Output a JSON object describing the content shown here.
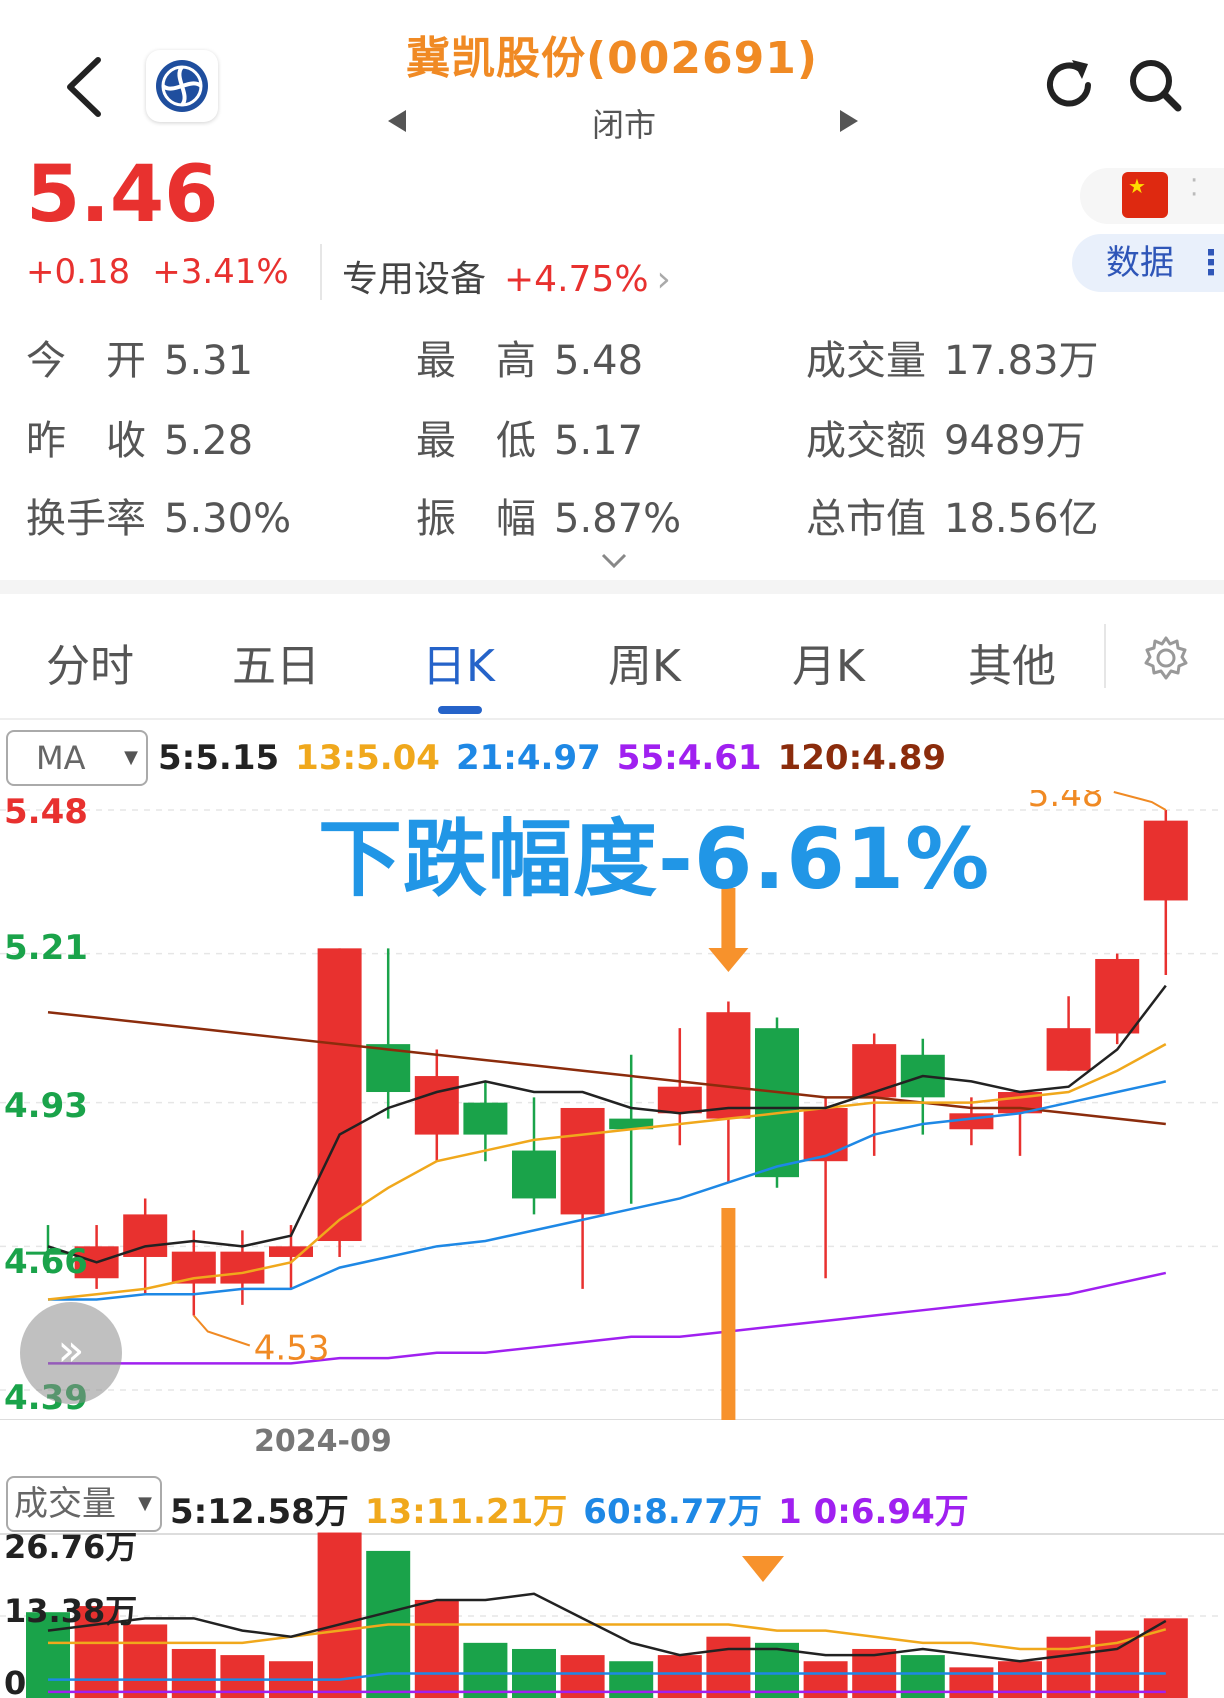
{
  "header": {
    "title": "冀凯股份(002691)",
    "status": "闭市",
    "back_icon": "chevron-left-icon",
    "refresh_icon": "refresh-icon",
    "search_icon": "search-icon"
  },
  "quote": {
    "price": "5.46",
    "change": "+0.18",
    "change_pct": "+3.41%",
    "sector": "专用设备",
    "sector_pct": "+4.75%",
    "data_button": "数据",
    "up_color": "#e8312f",
    "down_color": "#1aa34a"
  },
  "stats": [
    {
      "label": "今　开",
      "value": "5.31"
    },
    {
      "label": "最　高",
      "value": "5.48"
    },
    {
      "label": "成交量",
      "value": "17.83万"
    },
    {
      "label": "昨　收",
      "value": "5.28"
    },
    {
      "label": "最　低",
      "value": "5.17"
    },
    {
      "label": "成交额",
      "value": "9489万"
    },
    {
      "label": "换手率",
      "value": "5.30%"
    },
    {
      "label": "振　幅",
      "value": "5.87%"
    },
    {
      "label": "总市值",
      "value": "18.56亿"
    }
  ],
  "tabs": [
    "分时",
    "五日",
    "日K",
    "周K",
    "月K",
    "其他"
  ],
  "active_tab": "日K",
  "ma": {
    "selector": "MA",
    "legend": [
      {
        "text": "5:5.15",
        "color": "#222222"
      },
      {
        "text": "13:5.04",
        "color": "#f0a81c"
      },
      {
        "text": "21:4.97",
        "color": "#1e88e5"
      },
      {
        "text": "55:4.61",
        "color": "#a020f0"
      },
      {
        "text": "120:4.89",
        "color": "#8b2c0c"
      }
    ]
  },
  "price_axis": [
    {
      "text": "5.48",
      "color": "#e8312f"
    },
    {
      "text": "5.21",
      "color": "#1aa34a"
    },
    {
      "text": "4.93",
      "color": "#1aa34a"
    },
    {
      "text": "4.66",
      "color": "#1aa34a"
    },
    {
      "text": "4.39",
      "color": "#1aa34a"
    }
  ],
  "annotations": {
    "headline": "下跌幅度-6.61%",
    "high_marker": "5.48",
    "low_marker": "4.53",
    "date": "2024-09"
  },
  "volume": {
    "selector": "成交量",
    "legend": [
      {
        "text": "5:12.58万",
        "color": "#222222"
      },
      {
        "text": "13:11.21万",
        "color": "#f0a81c"
      },
      {
        "text": "60:8.77万",
        "color": "#1e88e5"
      },
      {
        "text": "1  0:6.94万",
        "color": "#a020f0"
      }
    ],
    "axis": [
      "26.76万",
      "13.38万",
      "0"
    ]
  },
  "chart_data": [
    {
      "type": "candlestick",
      "ylim": [
        4.39,
        5.48
      ],
      "candles": [
        {
          "o": 4.65,
          "c": 4.65,
          "h": 4.7,
          "l": 4.61,
          "up": false
        },
        {
          "o": 4.6,
          "c": 4.66,
          "h": 4.7,
          "l": 4.58,
          "up": true
        },
        {
          "o": 4.64,
          "c": 4.72,
          "h": 4.75,
          "l": 4.57,
          "up": true
        },
        {
          "o": 4.65,
          "c": 4.59,
          "h": 4.69,
          "l": 4.53,
          "up": true
        },
        {
          "o": 4.59,
          "c": 4.65,
          "h": 4.69,
          "l": 4.55,
          "up": true
        },
        {
          "o": 4.64,
          "c": 4.66,
          "h": 4.7,
          "l": 4.58,
          "up": true
        },
        {
          "o": 4.67,
          "c": 5.22,
          "h": 5.22,
          "l": 4.64,
          "up": true
        },
        {
          "o": 5.04,
          "c": 4.95,
          "h": 5.22,
          "l": 4.9,
          "up": false
        },
        {
          "o": 4.87,
          "c": 4.98,
          "h": 5.03,
          "l": 4.82,
          "up": true
        },
        {
          "o": 4.93,
          "c": 4.87,
          "h": 4.97,
          "l": 4.82,
          "up": false
        },
        {
          "o": 4.84,
          "c": 4.75,
          "h": 4.94,
          "l": 4.72,
          "up": false
        },
        {
          "o": 4.72,
          "c": 4.92,
          "h": 4.92,
          "l": 4.58,
          "up": true
        },
        {
          "o": 4.88,
          "c": 4.9,
          "h": 5.02,
          "l": 4.74,
          "up": false
        },
        {
          "o": 4.91,
          "c": 4.96,
          "h": 5.07,
          "l": 4.85,
          "up": true
        },
        {
          "o": 4.9,
          "c": 5.1,
          "h": 5.12,
          "l": 4.78,
          "up": true
        },
        {
          "o": 5.07,
          "c": 4.79,
          "h": 5.09,
          "l": 4.77,
          "up": false
        },
        {
          "o": 4.82,
          "c": 4.92,
          "h": 4.94,
          "l": 4.6,
          "up": true
        },
        {
          "o": 4.94,
          "c": 5.04,
          "h": 5.06,
          "l": 4.83,
          "up": true
        },
        {
          "o": 5.02,
          "c": 4.94,
          "h": 5.05,
          "l": 4.87,
          "up": false
        },
        {
          "o": 4.88,
          "c": 4.91,
          "h": 4.94,
          "l": 4.85,
          "up": true
        },
        {
          "o": 4.91,
          "c": 4.95,
          "h": 4.95,
          "l": 4.83,
          "up": true
        },
        {
          "o": 4.99,
          "c": 5.07,
          "h": 5.13,
          "l": 4.99,
          "up": true
        },
        {
          "o": 5.06,
          "c": 5.2,
          "h": 5.21,
          "l": 5.04,
          "up": true
        },
        {
          "o": 5.31,
          "c": 5.46,
          "h": 5.48,
          "l": 5.17,
          "up": true
        }
      ],
      "ma5": [
        4.66,
        4.63,
        4.66,
        4.67,
        4.66,
        4.68,
        4.87,
        4.92,
        4.95,
        4.97,
        4.95,
        4.95,
        4.92,
        4.91,
        4.92,
        4.92,
        4.92,
        4.95,
        4.98,
        4.97,
        4.95,
        4.96,
        5.03,
        5.15
      ],
      "ma13": [
        4.56,
        4.57,
        4.58,
        4.6,
        4.61,
        4.63,
        4.71,
        4.77,
        4.82,
        4.84,
        4.86,
        4.87,
        4.88,
        4.89,
        4.9,
        4.91,
        4.92,
        4.93,
        4.93,
        4.93,
        4.94,
        4.95,
        4.99,
        5.04
      ],
      "ma21": [
        4.56,
        4.56,
        4.57,
        4.57,
        4.58,
        4.58,
        4.62,
        4.64,
        4.66,
        4.67,
        4.69,
        4.71,
        4.73,
        4.75,
        4.78,
        4.81,
        4.83,
        4.87,
        4.89,
        4.9,
        4.91,
        4.93,
        4.95,
        4.97
      ],
      "ma55": [
        4.44,
        4.44,
        4.44,
        4.44,
        4.44,
        4.44,
        4.45,
        4.45,
        4.46,
        4.46,
        4.47,
        4.48,
        4.49,
        4.49,
        4.5,
        4.51,
        4.52,
        4.53,
        4.54,
        4.55,
        4.56,
        4.57,
        4.59,
        4.61
      ],
      "ma120": [
        5.1,
        5.09,
        5.08,
        5.07,
        5.06,
        5.05,
        5.04,
        5.03,
        5.02,
        5.01,
        5.0,
        4.99,
        4.98,
        4.97,
        4.96,
        4.95,
        4.94,
        4.94,
        4.93,
        4.92,
        4.92,
        4.91,
        4.9,
        4.89
      ]
    },
    {
      "type": "bar",
      "ylim": [
        0,
        26.76
      ],
      "unit": "万",
      "values": [
        14,
        15,
        12,
        8,
        7,
        6,
        27,
        24,
        16,
        9,
        8,
        7,
        6,
        7,
        10,
        9,
        6,
        8,
        7,
        5,
        6,
        10,
        11,
        13
      ],
      "up": [
        false,
        true,
        true,
        true,
        true,
        true,
        true,
        false,
        true,
        false,
        false,
        true,
        false,
        true,
        true,
        false,
        true,
        true,
        false,
        true,
        true,
        true,
        true,
        true
      ],
      "ma5": [
        11,
        12,
        13,
        13,
        11,
        10,
        12,
        14,
        16,
        16,
        17,
        13,
        9,
        7,
        8,
        8,
        7,
        7,
        8,
        7,
        6,
        7,
        8,
        12.58
      ],
      "ma13": [
        9,
        9,
        9,
        9,
        9,
        10,
        11,
        12,
        12,
        12,
        12,
        12,
        12,
        12,
        12,
        11,
        11,
        10,
        9,
        9,
        8,
        8,
        9,
        11.21
      ],
      "ma60": [
        3,
        3,
        3,
        3,
        3,
        3,
        3,
        4,
        4,
        4,
        4,
        4,
        4,
        4,
        4,
        4,
        4,
        4,
        4,
        4,
        4,
        4,
        4,
        4
      ],
      "ma120": [
        1,
        1,
        1,
        1,
        1,
        1,
        1,
        1,
        1,
        1,
        1,
        1,
        1,
        1,
        1,
        1,
        1,
        1,
        1,
        1,
        1,
        1,
        1,
        1
      ]
    }
  ]
}
